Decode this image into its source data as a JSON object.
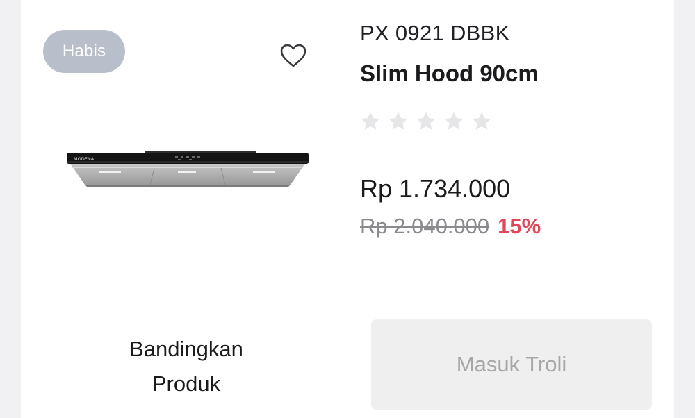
{
  "product": {
    "badge": "Habis",
    "model": "PX 0921 DBBK",
    "name": "Slim Hood 90cm",
    "image_brand": "MODENA",
    "rating": 0,
    "rating_max": 5,
    "price": "Rp 1.734.000",
    "original_price": "Rp 2.040.000",
    "discount": "15%"
  },
  "actions": {
    "compare_line1": "Bandingkan",
    "compare_line2": "Produk",
    "add_to_cart": "Masuk Troli"
  },
  "icons": {
    "wishlist": "heart-outline-icon",
    "rating": "star-icon"
  },
  "colors": {
    "badge_bg": "#b9bfca",
    "discount": "#e0475b",
    "star_empty": "#e6e6e8",
    "disabled_button_bg": "#efefef",
    "disabled_button_text": "#a6a6a6"
  }
}
